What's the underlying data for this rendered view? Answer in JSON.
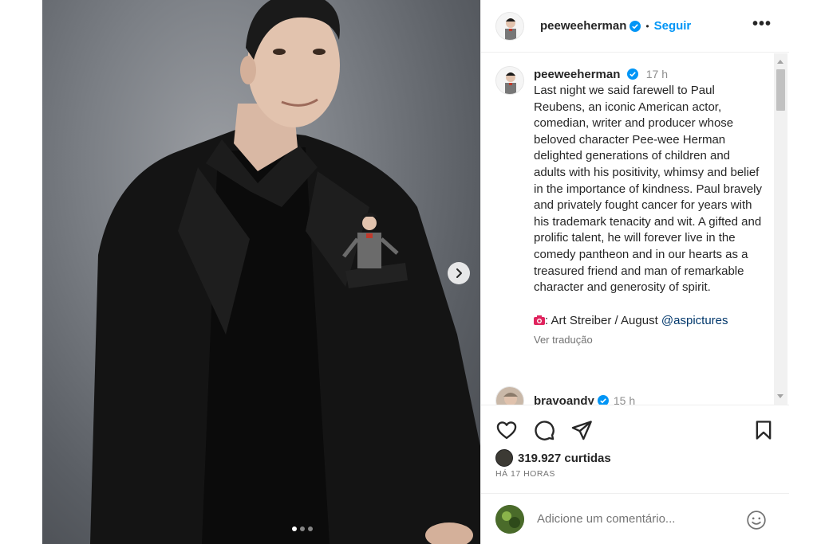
{
  "post": {
    "username": "peeweeherman",
    "follow_label": "Seguir",
    "separator": "•",
    "more_label": "•••",
    "carousel_dots": 3,
    "active_dot": 0
  },
  "caption": {
    "username": "peeweeherman",
    "time": "17 h",
    "text": "Last night we said farewell to Paul Reubens, an iconic American actor, comedian, writer and producer whose beloved character Pee-wee Herman delighted generations of children and adults with his positivity, whimsy and belief in the importance of kindness. Paul bravely and privately fought cancer for years with his trademark tenacity and wit. A gifted and prolific talent, he will forever live in the comedy pantheon and in our hearts as a treasured friend and man of remarkable character and generosity of spirit.",
    "credit_icon": "camera-emoji",
    "credit_text": ": Art Streiber / August ",
    "credit_handle": "@aspictures",
    "translate_label": "Ver tradução"
  },
  "reply": {
    "username": "bravoandy",
    "time": "15 h"
  },
  "engagement": {
    "likes": "319.927 curtidas",
    "posted_ago": "HÁ 17 HORAS"
  },
  "comment_box": {
    "placeholder": "Adicione um comentário..."
  },
  "colors": {
    "accent": "#0095f6",
    "verified": "#0095f6",
    "muted": "#737373"
  }
}
